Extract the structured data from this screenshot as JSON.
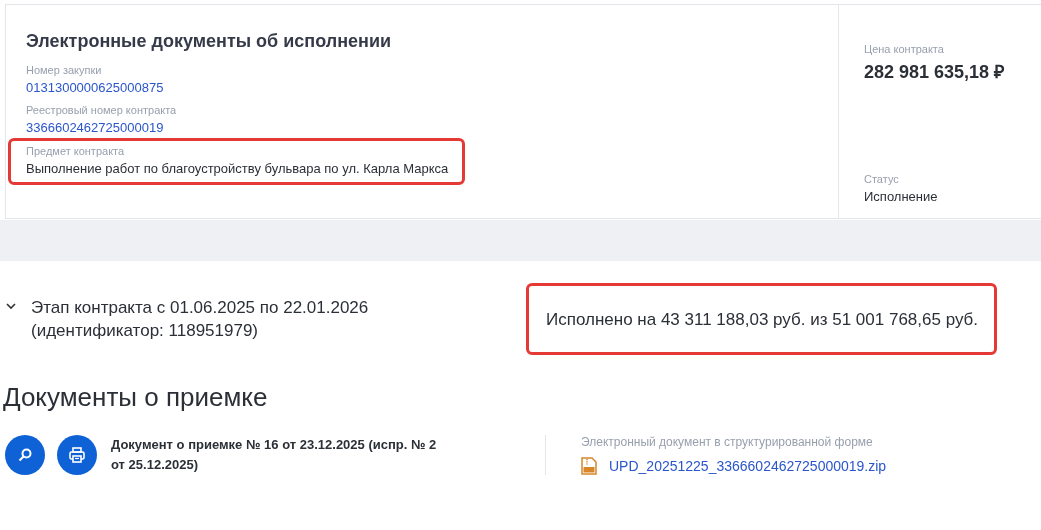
{
  "header": {
    "title": "Электронные документы об исполнении",
    "fields": [
      {
        "label": "Номер закупки",
        "value": "0131300000625000875",
        "kind": "link"
      },
      {
        "label": "Реестровый номер контракта",
        "value": "3366602462725000019",
        "kind": "link"
      },
      {
        "label": "Предмет контракта",
        "value": "Выполнение работ по благоустройству бульвара по ул. Карла Маркса",
        "kind": "text",
        "highlighted": true
      }
    ],
    "price": {
      "label": "Цена контракта",
      "value": "282 981 635,18 ₽"
    },
    "status": {
      "label": "Статус",
      "value": "Исполнение"
    }
  },
  "stage": {
    "expanded": true,
    "title": "Этап контракта с 01.06.2025 по 22.01.2026 (идентификатор: 118951979)",
    "summary": "Исполнено на 43 311 188,03 руб. из 51 001 768,65 руб.",
    "highlighted": true
  },
  "documents": {
    "heading": "Документы о приемке",
    "items": [
      {
        "title": "Документ о приемке № 16 от 23.12.2025 (испр. № 2 от 25.12.2025)",
        "file_label": "Электронный документ в структурированной форме",
        "file_name": "UPD_20251225_3366602462725000019.zip"
      }
    ]
  }
}
